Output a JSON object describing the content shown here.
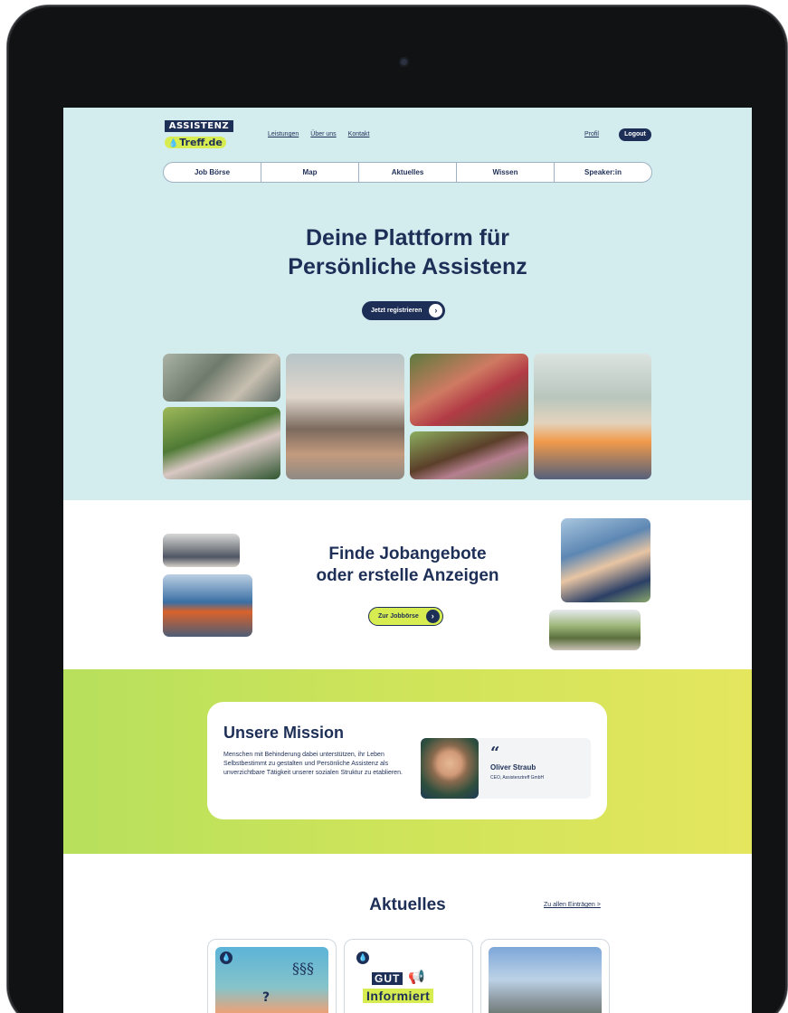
{
  "logo": {
    "line1": "ASSISTENZ",
    "line2": "Treff.de",
    "drop_icon": "drop-icon"
  },
  "header": {
    "links": [
      "Leistungen",
      "Über uns",
      "Kontakt"
    ],
    "profil": "Profil",
    "logout": "Logout"
  },
  "nav": [
    "Job Börse",
    "Map",
    "Aktuelles",
    "Wissen",
    "Speaker:in"
  ],
  "hero": {
    "title_line1": "Deine Plattform für",
    "title_line2": "Persönliche Assistenz",
    "cta": "Jetzt registrieren",
    "cta_icon": "chevron-right-icon"
  },
  "jobs": {
    "title_line1": "Finde Jobangebote",
    "title_line2": "oder erstelle Anzeigen",
    "cta": "Zur Jobbörse"
  },
  "mission": {
    "title": "Unsere Mission",
    "text": "Menschen mit Behinderung dabei unterstützen, ihr Leben Selbstbestimmt zu gestalten und Persönliche Assistenz als unverzichtbare Tätigkeit unserer sozialen Struktur zu etablieren.",
    "quote_mark": "“",
    "name": "Oliver Straub",
    "role": "CEO, Assistenztreff GmbH"
  },
  "news": {
    "title": "Aktuelles",
    "all_link": "Zu allen Einträgen >",
    "cards": [
      {
        "badge": "💧",
        "sections": "§§§",
        "question": "?"
      },
      {
        "badge": "💧",
        "gut": "GUT",
        "informiert": "Informiert"
      },
      {
        "badge": ""
      }
    ]
  },
  "colors": {
    "navy": "#1e2f57",
    "lime": "#d7ec50",
    "hero_bg": "#d3ecee"
  }
}
